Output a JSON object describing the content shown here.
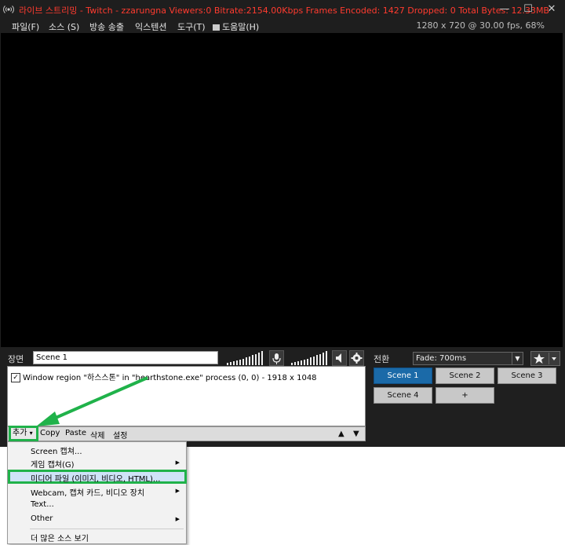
{
  "titlebar": {
    "title": "라이브 스트리밍 - Twitch - zzarungna  Viewers:0  Bitrate:2154.00Kbps  Frames Encoded: 1427 Dropped: 0  Total Bytes: 12.33MB",
    "minimize": "—",
    "maximize": "☐",
    "close": "✕"
  },
  "menubar": {
    "items": [
      "파일(F)",
      "소스 (S)",
      "방송 송출",
      "익스텐션",
      "도구(T)",
      "도움말(H)"
    ],
    "resolution_info": "1280 x 720 @ 30.00 fps, 68%"
  },
  "scenes_panel": {
    "label": "장면",
    "scene_name": "Scene 1"
  },
  "sources": {
    "items": [
      {
        "checked": true,
        "text": "Window region \"하스스톤\" in \"hearthstone.exe\" process (0, 0) - 1918 x 1048"
      }
    ]
  },
  "source_toolbar": {
    "add": "추가",
    "add_arrow": "▾",
    "copy": "Copy",
    "paste": "Paste",
    "delete": "삭제",
    "settings": "설정",
    "move_up": "▲",
    "move_down": "▼"
  },
  "transition": {
    "label": "전환",
    "selected": "Fade: 700ms"
  },
  "scene_buttons": [
    "Scene 1",
    "Scene 2",
    "Scene 3",
    "Scene 4",
    "+"
  ],
  "add_menu": {
    "items": [
      {
        "label": "Screen 캡쳐...",
        "submenu": false
      },
      {
        "label": "게임 캡쳐(G)",
        "submenu": true
      },
      {
        "label": "미디어 파일 (이미지, 비디오, HTML)...",
        "submenu": false,
        "highlighted": true
      },
      {
        "label": "Webcam, 캡쳐 카드, 비디오 장치",
        "submenu": true
      },
      {
        "label": "Text...",
        "submenu": false
      },
      {
        "label": "Other",
        "submenu": true
      },
      {
        "label": "더 많은 소스 보기",
        "submenu": false
      }
    ]
  },
  "colors": {
    "title_text": "#ff3b2f",
    "active_scene": "#1b6aa8",
    "highlight_border": "#20b24a"
  }
}
